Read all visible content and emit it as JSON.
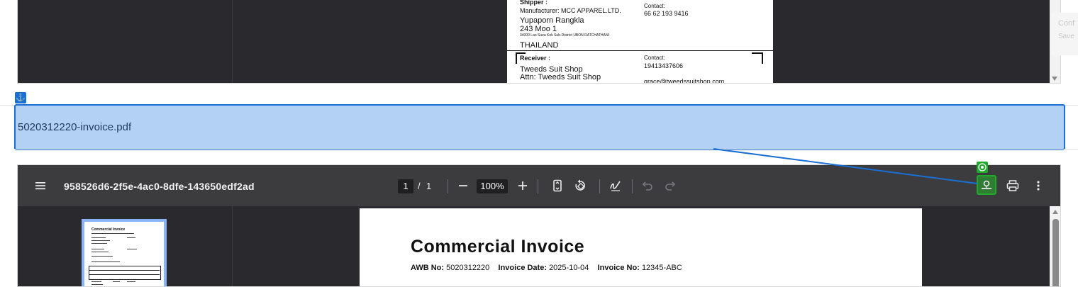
{
  "top_preview": {
    "shipper_label": "Shipper :",
    "manufacturer": "Manufacturer: MCC APPAREL.LTD.",
    "contact_name": "Yupaporn Rangkla",
    "address1": "243 Moo 1",
    "address2": "34000 Lao Suea Kok Sub-District UBON RATCHATHANI",
    "country": "THAILAND",
    "shipper_contact_label": "Contact:",
    "shipper_phone": "66 62 193 9416",
    "receiver_label": "Receiver :",
    "receiver_name": "Tweeds Suit Shop",
    "receiver_attn": "Attn: Tweeds Suit Shop",
    "receiver_contact_label": "Contact:",
    "receiver_phone": "19413437606",
    "receiver_email": "grace@tweedssuitshop.com"
  },
  "ghost_panel": {
    "line1": "Conf",
    "line2": "Save"
  },
  "file_link": {
    "name": "5020312220-invoice.pdf"
  },
  "viewer": {
    "doc_title": "958526d6-2f5e-4ac0-8dfe-143650edf2ad",
    "page_current": "1",
    "page_sep": "/",
    "page_total": "1",
    "zoom": "100%"
  },
  "thumbnail": {
    "title": "Commercial Invoice"
  },
  "invoice": {
    "title": "Commercial Invoice",
    "awb_label": "AWB No:",
    "awb_value": "5020312220",
    "date_label": "Invoice Date:",
    "date_value": "2025-10-04",
    "no_label": "Invoice No:",
    "no_value": "12345-ABC"
  },
  "colors": {
    "highlight": "#b3d1f5",
    "accent": "#1a6fd4",
    "download_highlight": "#1faa2a"
  },
  "icons": [
    "anchor-icon",
    "menu-icon",
    "minus-icon",
    "plus-icon",
    "fit-page-icon",
    "rotate-icon",
    "annotate-icon",
    "undo-icon",
    "redo-icon",
    "download-icon",
    "target-icon",
    "print-icon",
    "more-vert-icon"
  ]
}
